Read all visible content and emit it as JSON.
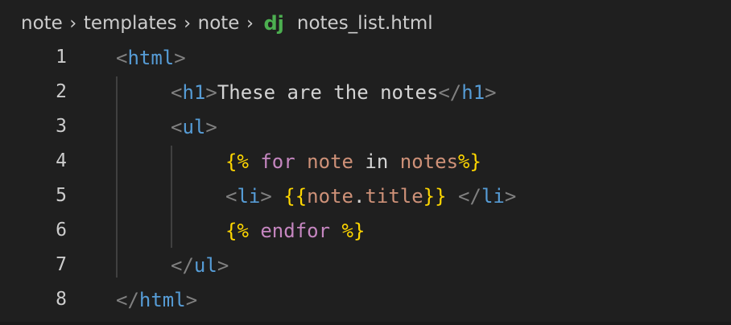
{
  "breadcrumb": {
    "items": [
      "note",
      "templates",
      "note"
    ],
    "file_icon": "dj",
    "file_name": "notes_list.html",
    "separator": ">"
  },
  "lines": [
    {
      "number": "1",
      "indent": 0,
      "tokens": [
        {
          "t": "<",
          "c": "br"
        },
        {
          "t": "html",
          "c": "tag"
        },
        {
          "t": ">",
          "c": "br"
        }
      ]
    },
    {
      "number": "2",
      "indent": 1,
      "tokens": [
        {
          "t": "<",
          "c": "br"
        },
        {
          "t": "h1",
          "c": "tag"
        },
        {
          "t": ">",
          "c": "br"
        },
        {
          "t": "These are the notes",
          "c": "txt"
        },
        {
          "t": "</",
          "c": "br"
        },
        {
          "t": "h1",
          "c": "tag"
        },
        {
          "t": ">",
          "c": "br"
        }
      ]
    },
    {
      "number": "3",
      "indent": 1,
      "tokens": [
        {
          "t": "<",
          "c": "br"
        },
        {
          "t": "ul",
          "c": "tag"
        },
        {
          "t": ">",
          "c": "br"
        }
      ]
    },
    {
      "number": "4",
      "indent": 2,
      "tokens": [
        {
          "t": "{%",
          "c": "dl"
        },
        {
          "t": " ",
          "c": "plain"
        },
        {
          "t": "for",
          "c": "kw"
        },
        {
          "t": " ",
          "c": "plain"
        },
        {
          "t": "note",
          "c": "var"
        },
        {
          "t": " in ",
          "c": "plain"
        },
        {
          "t": "notes",
          "c": "var"
        },
        {
          "t": "%}",
          "c": "dl"
        }
      ]
    },
    {
      "number": "5",
      "indent": 2,
      "tokens": [
        {
          "t": "<",
          "c": "br"
        },
        {
          "t": "li",
          "c": "tag"
        },
        {
          "t": ">",
          "c": "br"
        },
        {
          "t": " ",
          "c": "plain"
        },
        {
          "t": "{{",
          "c": "dl"
        },
        {
          "t": "note",
          "c": "var"
        },
        {
          "t": ".",
          "c": "plain"
        },
        {
          "t": "title",
          "c": "var"
        },
        {
          "t": "}}",
          "c": "dl"
        },
        {
          "t": " ",
          "c": "plain"
        },
        {
          "t": "</",
          "c": "br"
        },
        {
          "t": "li",
          "c": "tag"
        },
        {
          "t": ">",
          "c": "br"
        }
      ]
    },
    {
      "number": "6",
      "indent": 2,
      "tokens": [
        {
          "t": "{%",
          "c": "dl"
        },
        {
          "t": " ",
          "c": "plain"
        },
        {
          "t": "endfor",
          "c": "kw"
        },
        {
          "t": " ",
          "c": "plain"
        },
        {
          "t": "%}",
          "c": "dl"
        }
      ]
    },
    {
      "number": "7",
      "indent": 1,
      "tokens": [
        {
          "t": "</",
          "c": "br"
        },
        {
          "t": "ul",
          "c": "tag"
        },
        {
          "t": ">",
          "c": "br"
        }
      ]
    },
    {
      "number": "8",
      "indent": 0,
      "tokens": [
        {
          "t": "</",
          "c": "br"
        },
        {
          "t": "html",
          "c": "tag"
        },
        {
          "t": ">",
          "c": "br"
        }
      ]
    }
  ]
}
